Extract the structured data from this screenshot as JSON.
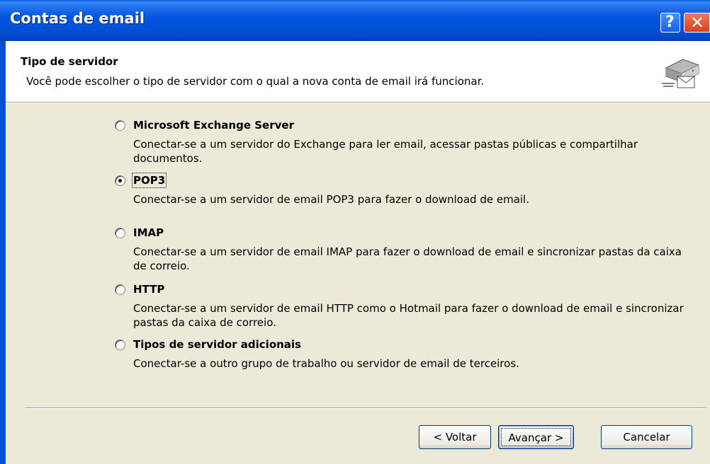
{
  "window": {
    "title": "Contas de email"
  },
  "header": {
    "title": "Tipo de servidor",
    "description": "Você pode escolher o tipo de servidor com o qual a nova conta de email irá funcionar."
  },
  "options": [
    {
      "label": "Microsoft Exchange Server",
      "description": "Conectar-se a um servidor do Exchange para ler email, acessar pastas públicas e compartilhar documentos.",
      "selected": false
    },
    {
      "label": "POP3",
      "description": "Conectar-se a um servidor de email POP3 para fazer o download de email.",
      "selected": true
    },
    {
      "label": "IMAP",
      "description": "Conectar-se a um servidor de email IMAP para fazer o download de email e sincronizar pastas da caixa de correio.",
      "selected": false
    },
    {
      "label": "HTTP",
      "description": "Conectar-se a um servidor de email HTTP como o Hotmail para fazer o download de email e sincronizar pastas da caixa de correio.",
      "selected": false
    },
    {
      "label": "Tipos de servidor adicionais",
      "description": "Conectar-se a outro grupo de trabalho ou servidor de email de terceiros.",
      "selected": false
    }
  ],
  "buttons": {
    "back": "< Voltar",
    "next": "Avançar >",
    "cancel": "Cancelar"
  },
  "icons": {
    "help": "help-icon",
    "close": "close-icon",
    "header": "server-mail-icon"
  }
}
